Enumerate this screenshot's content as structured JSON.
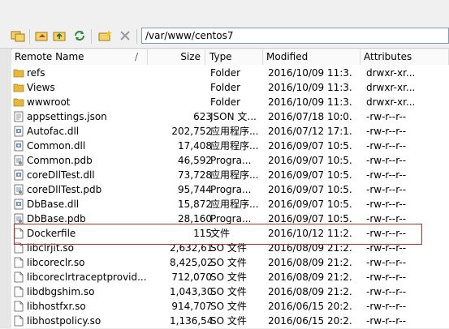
{
  "path": "/var/www/centos7",
  "columns": {
    "name": "Remote Name",
    "sort_indicator": "/",
    "size": "Size",
    "type": "Type",
    "modified": "Modified",
    "attributes": "Attributes"
  },
  "toolbar": {
    "icons": [
      "connect-icon",
      "home-icon",
      "up-folder-icon",
      "refresh-icon",
      "new-folder-icon",
      "delete-icon"
    ]
  },
  "files": [
    {
      "name": "refs",
      "size": "",
      "type": "Folder",
      "modified": "2016/10/09 11:3...",
      "attributes": "drwxr-xr...",
      "icon": "folder"
    },
    {
      "name": "Views",
      "size": "",
      "type": "Folder",
      "modified": "2016/10/09 11:3...",
      "attributes": "drwxr-xr...",
      "icon": "folder"
    },
    {
      "name": "wwwroot",
      "size": "",
      "type": "Folder",
      "modified": "2016/10/09 11:3...",
      "attributes": "drwxr-xr...",
      "icon": "folder"
    },
    {
      "name": "appsettings.json",
      "size": "623",
      "type": "JSON 文...",
      "modified": "2016/07/18 10:0...",
      "attributes": "-rw-r--r--",
      "icon": "doc"
    },
    {
      "name": "Autofac.dll",
      "size": "202,752",
      "type": "应用程序...",
      "modified": "2016/07/12 17:1...",
      "attributes": "-rw-r--r--",
      "icon": "dll"
    },
    {
      "name": "Common.dll",
      "size": "17,408",
      "type": "应用程序...",
      "modified": "2016/09/07 10:5...",
      "attributes": "-rw-r--r--",
      "icon": "dll"
    },
    {
      "name": "Common.pdb",
      "size": "46,592",
      "type": "Progra...",
      "modified": "2016/09/07 10:5...",
      "attributes": "-rw-r--r--",
      "icon": "pdb"
    },
    {
      "name": "coreDllTest.dll",
      "size": "73,728",
      "type": "应用程序...",
      "modified": "2016/09/07 10:5...",
      "attributes": "-rw-r--r--",
      "icon": "dll"
    },
    {
      "name": "coreDllTest.pdb",
      "size": "95,744",
      "type": "Progra...",
      "modified": "2016/09/07 10:5...",
      "attributes": "-rw-r--r--",
      "icon": "pdb"
    },
    {
      "name": "DbBase.dll",
      "size": "15,872",
      "type": "应用程序...",
      "modified": "2016/09/07 10:5...",
      "attributes": "-rw-r--r--",
      "icon": "dll"
    },
    {
      "name": "DbBase.pdb",
      "size": "28,160",
      "type": "Progra...",
      "modified": "2016/09/07 10:5...",
      "attributes": "-rw-r--r--",
      "icon": "pdb"
    },
    {
      "name": "Dockerfile",
      "size": "115",
      "type": "文件",
      "modified": "2016/10/12 11:2...",
      "attributes": "-rw-r--r--",
      "icon": "file"
    },
    {
      "name": "libclrjit.so",
      "size": "2,632,615",
      "type": "SO 文件",
      "modified": "2016/08/09 21:2...",
      "attributes": "-rw-r--r--",
      "icon": "file"
    },
    {
      "name": "libcoreclr.so",
      "size": "8,425,021",
      "type": "SO 文件",
      "modified": "2016/08/09 21:2...",
      "attributes": "-rw-r--r--",
      "icon": "file"
    },
    {
      "name": "libcoreclrtraceptprovid...",
      "size": "712,070",
      "type": "SO 文件",
      "modified": "2016/08/09 21:2...",
      "attributes": "-rw-r--r--",
      "icon": "file"
    },
    {
      "name": "libdbgshim.so",
      "size": "1,043,309",
      "type": "SO 文件",
      "modified": "2016/08/09 21:2...",
      "attributes": "-rw-r--r--",
      "icon": "file"
    },
    {
      "name": "libhostfxr.so",
      "size": "914,707",
      "type": "SO 文件",
      "modified": "2016/06/15 20:2...",
      "attributes": "-rw-r--r--",
      "icon": "file"
    },
    {
      "name": "libhostpolicy.so",
      "size": "1,136,541",
      "type": "SO 文件",
      "modified": "2016/06/15 20:2...",
      "attributes": "-rw-r--r--",
      "icon": "file"
    }
  ],
  "colors": {
    "folder": "#e8b83a",
    "selection_outline": "#c03030",
    "path_border": "#7a9ebe"
  }
}
